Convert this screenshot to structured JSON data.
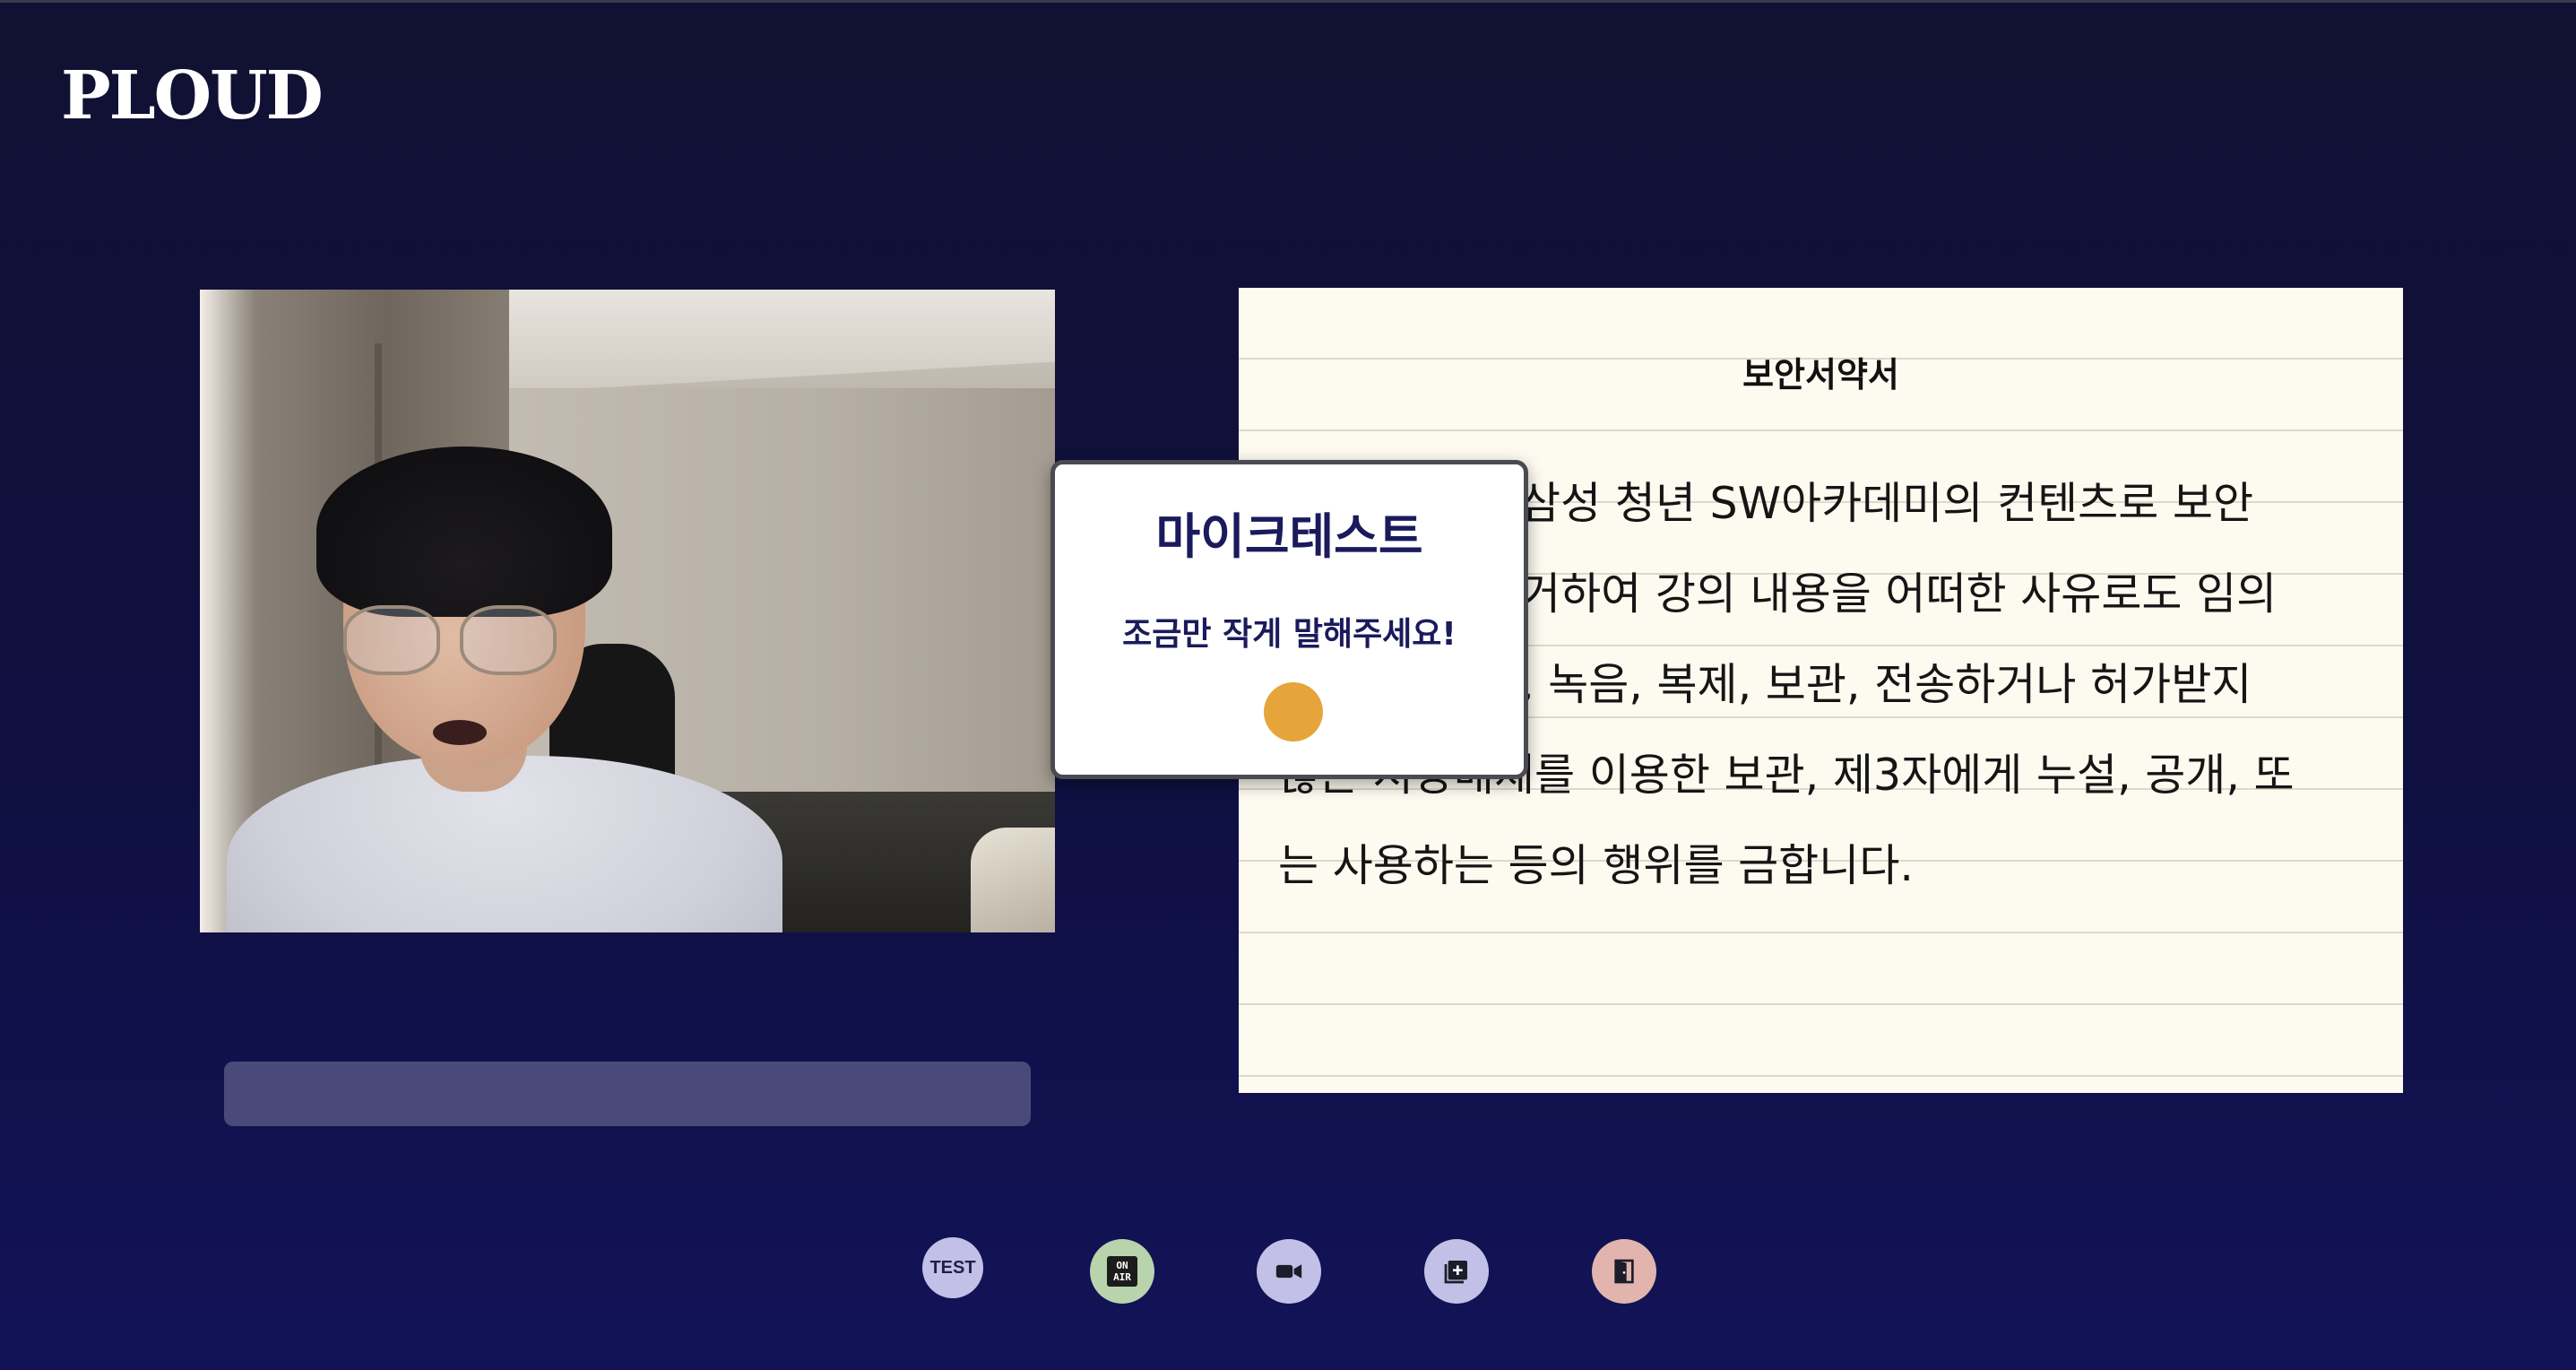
{
  "app": {
    "logo": "PLOUD"
  },
  "document": {
    "title": "보안서약서",
    "lines": [
      "삼성 청년 SW아카데미의 컨텐츠로 보안",
      "거하여 강의 내용을 어떠한 사유로도 임의",
      ", 녹음, 복제, 보관, 전송하거나 허가받지",
      "않은 저장매체를 이용한 보관, 제3자에게 누설, 공개, 또",
      "는 사용하는 등의 행위를 금합니다."
    ]
  },
  "popup": {
    "title": "마이크테스트",
    "message": "조금만 작게 말해주세요!",
    "indicator_color": "#e6a53a"
  },
  "toolbar": {
    "test_label": "TEST",
    "onair_label_top": "ON",
    "onair_label_bottom": "AIR",
    "buttons": [
      {
        "name": "test-button",
        "icon": "test-icon"
      },
      {
        "name": "on-air-button",
        "icon": "on-air-icon"
      },
      {
        "name": "video-button",
        "icon": "video-camera-icon"
      },
      {
        "name": "add-button",
        "icon": "add-box-icon"
      },
      {
        "name": "exit-button",
        "icon": "exit-door-icon"
      }
    ]
  },
  "colors": {
    "background": "#111133",
    "caption_bar": "#4a4a7a",
    "toolbar_default": "#c2c0e6",
    "toolbar_onair": "#b9d3ad",
    "toolbar_exit": "#e1b5ad"
  }
}
